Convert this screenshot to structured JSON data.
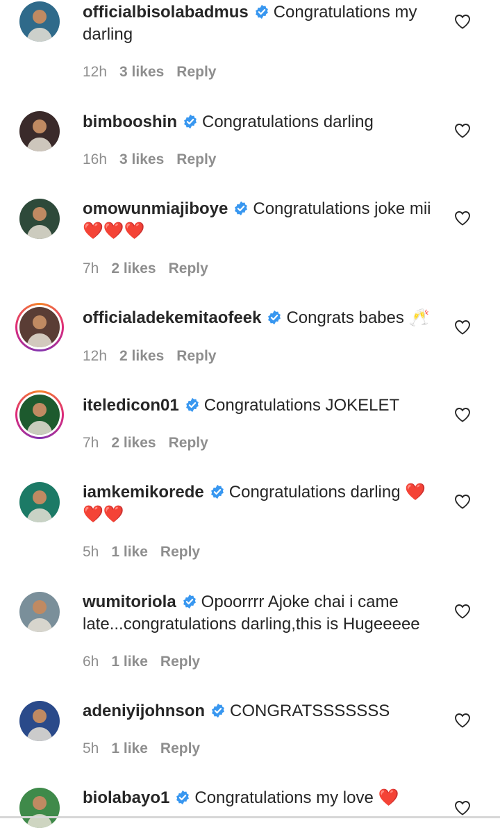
{
  "comments": [
    {
      "username": "officialbisolabadmus",
      "text": "Congratulations my darling",
      "time": "12h",
      "likes": "3 likes",
      "reply": "Reply",
      "avatar_color": "#2f6a8a",
      "ring": false
    },
    {
      "username": "bimbooshin",
      "text": "Congratulations darling",
      "time": "16h",
      "likes": "3 likes",
      "reply": "Reply",
      "avatar_color": "#3a2a2a",
      "ring": false
    },
    {
      "username": "omowunmiajiboye",
      "text": "Congratulations joke mii❤️❤️❤️",
      "time": "7h",
      "likes": "2 likes",
      "reply": "Reply",
      "avatar_color": "#2e4a3a",
      "ring": false
    },
    {
      "username": "officialadekemitaofeek",
      "text": "Congrats babes 🥂",
      "time": "12h",
      "likes": "2 likes",
      "reply": "Reply",
      "avatar_color": "#5a3d35",
      "ring": true
    },
    {
      "username": "iteledicon01",
      "text": "Congratulations JOKELET",
      "time": "7h",
      "likes": "2 likes",
      "reply": "Reply",
      "avatar_color": "#1d5a2e",
      "ring": true
    },
    {
      "username": "iamkemikorede",
      "text": "Congratulations darling ❤️❤️❤️",
      "time": "5h",
      "likes": "1 like",
      "reply": "Reply",
      "avatar_color": "#1c7a66",
      "ring": false
    },
    {
      "username": "wumitoriola",
      "text": "Opoorrrr Ajoke chai i came late...congratulations darling,this is Hugeeeee",
      "time": "6h",
      "likes": "1 like",
      "reply": "Reply",
      "avatar_color": "#7a8f9a",
      "ring": false
    },
    {
      "username": "adeniyijohnson",
      "text": "CONGRATSSSSSSS",
      "time": "5h",
      "likes": "1 like",
      "reply": "Reply",
      "avatar_color": "#2a4a8a",
      "ring": false
    },
    {
      "username": "biolabayo1",
      "text": "Congratulations my love ❤️",
      "time": "",
      "likes": "",
      "reply": "",
      "avatar_color": "#3f8a4a",
      "ring": false
    }
  ],
  "colors": {
    "verified": "#3897f0",
    "meta": "#8e8e8e",
    "text": "#262626"
  },
  "icons": {
    "verified": "verified-badge-icon",
    "like": "heart-outline-icon"
  }
}
